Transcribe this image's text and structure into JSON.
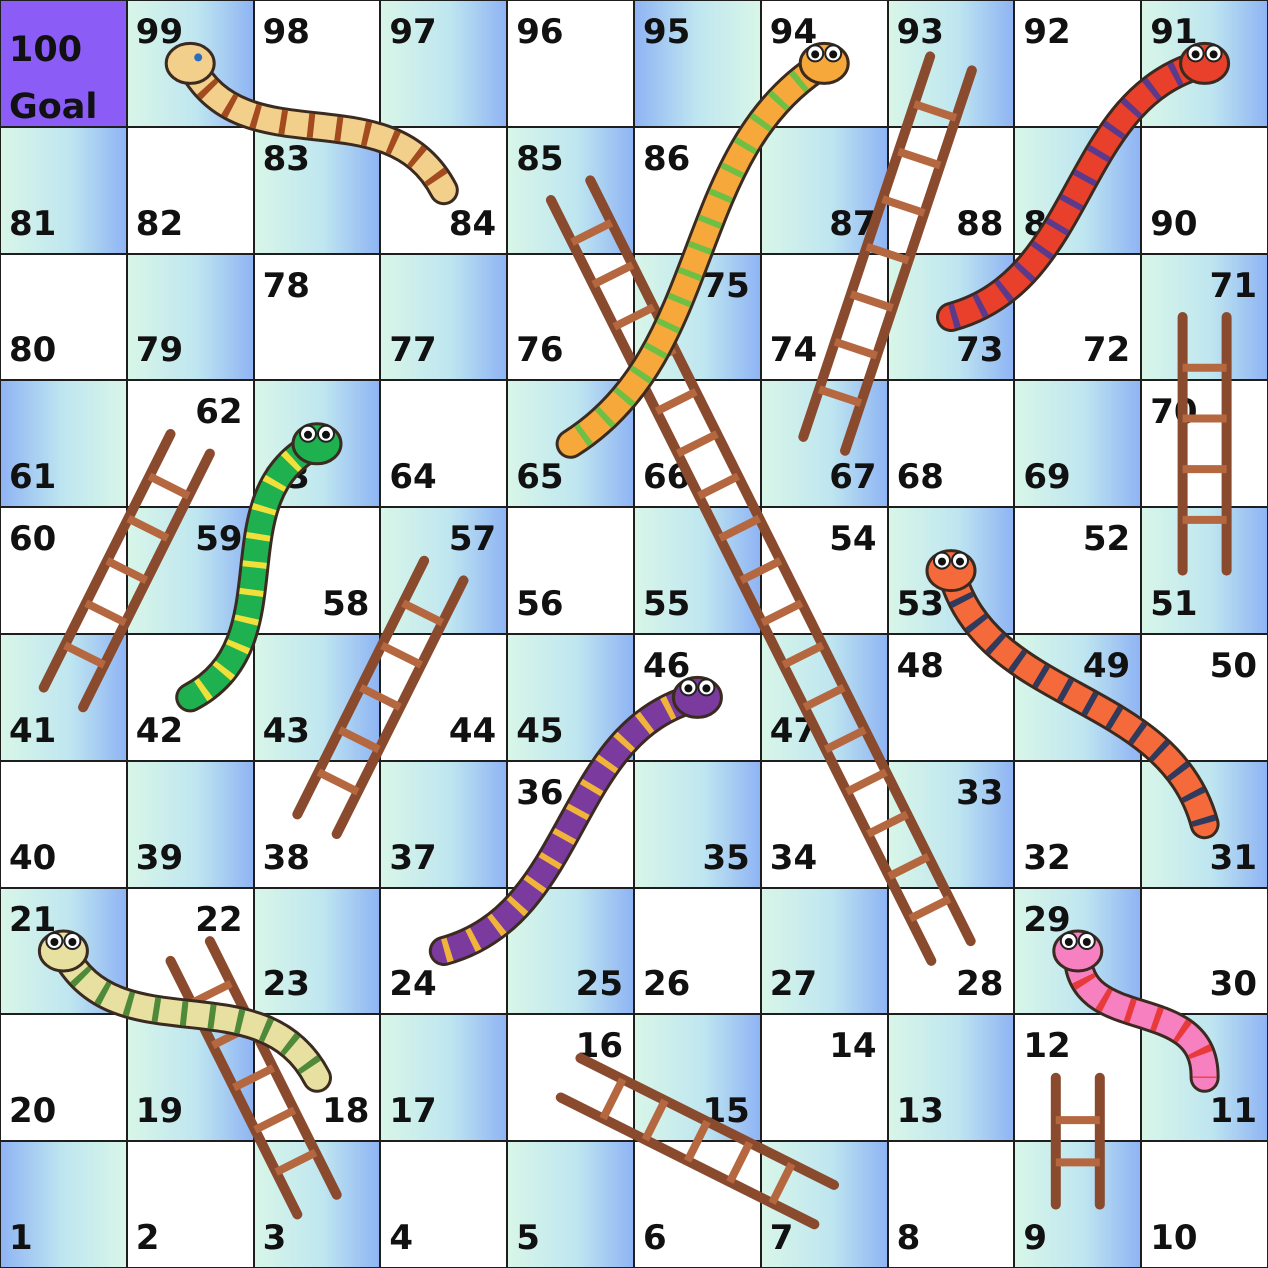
{
  "goal": {
    "number": "100",
    "label": "Goal"
  },
  "colors": {
    "goal": "#8b5cf6",
    "ladder": "#8a4a2e",
    "grid": "#1e1e1e"
  },
  "rows": [
    {
      "cells": [
        {
          "n": "100",
          "goal": true
        },
        {
          "n": "99",
          "pos": "tl",
          "bg": "grad-a"
        },
        {
          "n": "98",
          "pos": "tl",
          "bg": "white"
        },
        {
          "n": "97",
          "pos": "tl",
          "bg": "grad-a"
        },
        {
          "n": "96",
          "pos": "tl",
          "bg": "white"
        },
        {
          "n": "95",
          "pos": "tl",
          "bg": "grad-b"
        },
        {
          "n": "94",
          "pos": "tl",
          "bg": "white"
        },
        {
          "n": "93",
          "pos": "tl",
          "bg": "grad-a"
        },
        {
          "n": "92",
          "pos": "tl",
          "bg": "white"
        },
        {
          "n": "91",
          "pos": "tl",
          "bg": "grad-a"
        }
      ]
    },
    {
      "cells": [
        {
          "n": "81",
          "pos": "bl",
          "bg": "grad-a"
        },
        {
          "n": "82",
          "pos": "bl",
          "bg": "white"
        },
        {
          "n": "83",
          "pos": "tl",
          "bg": "grad-a"
        },
        {
          "n": "84",
          "pos": "br",
          "bg": "white"
        },
        {
          "n": "85",
          "pos": "tl",
          "bg": "grad-a"
        },
        {
          "n": "86",
          "pos": "tl",
          "bg": "white"
        },
        {
          "n": "87",
          "pos": "br",
          "bg": "grad-a"
        },
        {
          "n": "88",
          "pos": "br",
          "bg": "white"
        },
        {
          "n": "89",
          "pos": "bl",
          "bg": "grad-a"
        },
        {
          "n": "90",
          "pos": "bl",
          "bg": "white"
        }
      ]
    },
    {
      "cells": [
        {
          "n": "80",
          "pos": "bl",
          "bg": "white"
        },
        {
          "n": "79",
          "pos": "bl",
          "bg": "grad-a"
        },
        {
          "n": "78",
          "pos": "tl",
          "bg": "white"
        },
        {
          "n": "77",
          "pos": "bl",
          "bg": "grad-a"
        },
        {
          "n": "76",
          "pos": "bl",
          "bg": "white"
        },
        {
          "n": "75",
          "pos": "tr",
          "bg": "grad-a"
        },
        {
          "n": "74",
          "pos": "bl",
          "bg": "white"
        },
        {
          "n": "73",
          "pos": "br",
          "bg": "grad-a"
        },
        {
          "n": "72",
          "pos": "br",
          "bg": "white"
        },
        {
          "n": "71",
          "pos": "tr",
          "bg": "grad-a"
        }
      ]
    },
    {
      "cells": [
        {
          "n": "61",
          "pos": "bl",
          "bg": "grad-b"
        },
        {
          "n": "62",
          "pos": "tr",
          "bg": "white"
        },
        {
          "n": "63",
          "pos": "bl",
          "bg": "grad-a"
        },
        {
          "n": "64",
          "pos": "bl",
          "bg": "white"
        },
        {
          "n": "65",
          "pos": "bl",
          "bg": "grad-a"
        },
        {
          "n": "66",
          "pos": "bl",
          "bg": "white"
        },
        {
          "n": "67",
          "pos": "br",
          "bg": "grad-a"
        },
        {
          "n": "68",
          "pos": "bl",
          "bg": "white"
        },
        {
          "n": "69",
          "pos": "bl",
          "bg": "grad-a"
        },
        {
          "n": "70",
          "pos": "tl",
          "bg": "white"
        }
      ]
    },
    {
      "cells": [
        {
          "n": "60",
          "pos": "tl",
          "bg": "white"
        },
        {
          "n": "59",
          "pos": "tr",
          "bg": "grad-a"
        },
        {
          "n": "58",
          "pos": "br",
          "bg": "white"
        },
        {
          "n": "57",
          "pos": "tr",
          "bg": "grad-a"
        },
        {
          "n": "56",
          "pos": "bl",
          "bg": "white"
        },
        {
          "n": "55",
          "pos": "bl",
          "bg": "grad-a"
        },
        {
          "n": "54",
          "pos": "tr",
          "bg": "white"
        },
        {
          "n": "53",
          "pos": "bl",
          "bg": "grad-a"
        },
        {
          "n": "52",
          "pos": "tr",
          "bg": "white"
        },
        {
          "n": "51",
          "pos": "bl",
          "bg": "grad-a"
        }
      ]
    },
    {
      "cells": [
        {
          "n": "41",
          "pos": "bl",
          "bg": "grad-a"
        },
        {
          "n": "42",
          "pos": "bl",
          "bg": "white"
        },
        {
          "n": "43",
          "pos": "bl",
          "bg": "grad-a"
        },
        {
          "n": "44",
          "pos": "br",
          "bg": "white"
        },
        {
          "n": "45",
          "pos": "bl",
          "bg": "grad-a"
        },
        {
          "n": "46",
          "pos": "tl",
          "bg": "white"
        },
        {
          "n": "47",
          "pos": "bl",
          "bg": "grad-a"
        },
        {
          "n": "48",
          "pos": "tl",
          "bg": "white"
        },
        {
          "n": "49",
          "pos": "tr",
          "bg": "grad-a"
        },
        {
          "n": "50",
          "pos": "tr",
          "bg": "white"
        }
      ]
    },
    {
      "cells": [
        {
          "n": "40",
          "pos": "bl",
          "bg": "white"
        },
        {
          "n": "39",
          "pos": "bl",
          "bg": "grad-a"
        },
        {
          "n": "38",
          "pos": "bl",
          "bg": "white"
        },
        {
          "n": "37",
          "pos": "bl",
          "bg": "grad-a"
        },
        {
          "n": "36",
          "pos": "tl",
          "bg": "white"
        },
        {
          "n": "35",
          "pos": "br",
          "bg": "grad-a"
        },
        {
          "n": "34",
          "pos": "bl",
          "bg": "white"
        },
        {
          "n": "33",
          "pos": "tr",
          "bg": "grad-a"
        },
        {
          "n": "32",
          "pos": "bl",
          "bg": "white"
        },
        {
          "n": "31",
          "pos": "br",
          "bg": "grad-a"
        }
      ]
    },
    {
      "cells": [
        {
          "n": "21",
          "pos": "tl",
          "bg": "grad-a"
        },
        {
          "n": "22",
          "pos": "tr",
          "bg": "white"
        },
        {
          "n": "23",
          "pos": "bl",
          "bg": "grad-a"
        },
        {
          "n": "24",
          "pos": "bl",
          "bg": "white"
        },
        {
          "n": "25",
          "pos": "br",
          "bg": "grad-a"
        },
        {
          "n": "26",
          "pos": "bl",
          "bg": "white"
        },
        {
          "n": "27",
          "pos": "bl",
          "bg": "grad-a"
        },
        {
          "n": "28",
          "pos": "br",
          "bg": "white"
        },
        {
          "n": "29",
          "pos": "tl",
          "bg": "grad-a"
        },
        {
          "n": "30",
          "pos": "br",
          "bg": "white"
        }
      ]
    },
    {
      "cells": [
        {
          "n": "20",
          "pos": "bl",
          "bg": "white"
        },
        {
          "n": "19",
          "pos": "bl",
          "bg": "grad-a"
        },
        {
          "n": "18",
          "pos": "br",
          "bg": "white"
        },
        {
          "n": "17",
          "pos": "bl",
          "bg": "grad-a"
        },
        {
          "n": "16",
          "pos": "tr",
          "bg": "white"
        },
        {
          "n": "15",
          "pos": "br",
          "bg": "grad-a"
        },
        {
          "n": "14",
          "pos": "tr",
          "bg": "white"
        },
        {
          "n": "13",
          "pos": "bl",
          "bg": "grad-a"
        },
        {
          "n": "12",
          "pos": "tl",
          "bg": "white"
        },
        {
          "n": "11",
          "pos": "br",
          "bg": "grad-a"
        }
      ]
    },
    {
      "cells": [
        {
          "n": "1",
          "pos": "bl",
          "bg": "grad-b"
        },
        {
          "n": "2",
          "pos": "bl",
          "bg": "white"
        },
        {
          "n": "3",
          "pos": "bl",
          "bg": "grad-a"
        },
        {
          "n": "4",
          "pos": "bl",
          "bg": "white"
        },
        {
          "n": "5",
          "pos": "bl",
          "bg": "grad-a"
        },
        {
          "n": "6",
          "pos": "bl",
          "bg": "white"
        },
        {
          "n": "7",
          "pos": "bl",
          "bg": "grad-a"
        },
        {
          "n": "8",
          "pos": "bl",
          "bg": "white"
        },
        {
          "n": "9",
          "pos": "bl",
          "bg": "grad-a"
        },
        {
          "n": "10",
          "pos": "bl",
          "bg": "white"
        }
      ]
    }
  ],
  "snakes": [
    {
      "name": "snake-head-99-tail-84",
      "head": "99",
      "tail": "84",
      "color": "#f2cf8a",
      "stripe": "#a34a1e",
      "eyes": false
    },
    {
      "name": "snake-head-94-tail-65",
      "head": "94",
      "tail": "65",
      "color": "#f7a83a",
      "stripe": "#6fbf44",
      "eyes": true
    },
    {
      "name": "snake-head-91-tail-73",
      "head": "91",
      "tail": "73",
      "color": "#e8402a",
      "stripe": "#5b3a8c",
      "eyes": true
    },
    {
      "name": "snake-head-63-tail-42",
      "head": "63",
      "tail": "42",
      "color": "#1fb050",
      "stripe": "#f2e03a",
      "eyes": true
    },
    {
      "name": "snake-head-53-tail-31",
      "head": "53",
      "tail": "31",
      "color": "#f56a3a",
      "stripe": "#2f3a5c",
      "eyes": true
    },
    {
      "name": "snake-head-46-tail-24",
      "head": "46",
      "tail": "24",
      "color": "#7b3a9e",
      "stripe": "#f0b43a",
      "eyes": true
    },
    {
      "name": "snake-head-21-tail-18",
      "head": "21",
      "tail": "18",
      "color": "#e8e0a0",
      "stripe": "#4f8a3a",
      "eyes": true
    },
    {
      "name": "snake-head-29-tail-11",
      "head": "29",
      "tail": "11",
      "color": "#f780c0",
      "stripe": "#e83a3a",
      "eyes": true
    }
  ],
  "ladders": [
    {
      "name": "ladder-28-to-85",
      "from": "28",
      "to": "85"
    },
    {
      "name": "ladder-67-to-93",
      "from": "67",
      "to": "93"
    },
    {
      "name": "ladder-51-to-71",
      "from": "51",
      "to": "71"
    },
    {
      "name": "ladder-41-to-62",
      "from": "41",
      "to": "62"
    },
    {
      "name": "ladder-38-to-57",
      "from": "38",
      "to": "57"
    },
    {
      "name": "ladder-3-to-22",
      "from": "3",
      "to": "22"
    },
    {
      "name": "ladder-7-to-16",
      "from": "7",
      "to": "16"
    },
    {
      "name": "ladder-9-to-12",
      "from": "9",
      "to": "12"
    }
  ]
}
